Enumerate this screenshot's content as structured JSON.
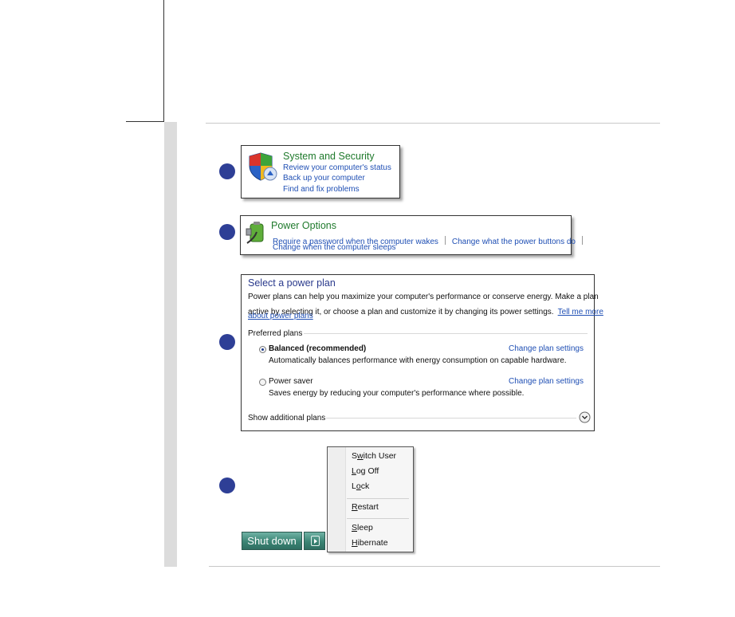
{
  "system_security": {
    "title": "System and Security",
    "links": [
      "Review your computer's status",
      "Back up your computer",
      "Find and fix problems"
    ]
  },
  "power_options": {
    "title": "Power Options",
    "link1": "Require a password when the computer wakes",
    "link2": "Change what the power buttons do",
    "link3": "Change when the computer sleeps"
  },
  "power_plan": {
    "title": "Select a power plan",
    "desc_line1": "Power plans can help you maximize your computer's performance or conserve energy. Make a plan",
    "desc_line2": "active by selecting it, or choose a plan and customize it by changing its power settings.",
    "tell_more_1": "Tell me more",
    "tell_more_2": "about power plans",
    "preferred_label": "Preferred plans",
    "plans": [
      {
        "name": "Balanced (recommended)",
        "desc": "Automatically balances performance with energy consumption on capable hardware.",
        "change": "Change plan settings",
        "selected": true
      },
      {
        "name": "Power saver",
        "desc": "Saves energy by reducing your computer's performance where possible.",
        "change": "Change plan settings",
        "selected": false
      }
    ],
    "show_more": "Show additional plans"
  },
  "shutdown_menu": {
    "button_label": "Shut down",
    "items": [
      "Switch User",
      "Log Off",
      "Lock",
      "Restart",
      "Sleep",
      "Hibernate"
    ],
    "mnemonics": [
      "w",
      "L",
      "o",
      "R",
      "S",
      "H"
    ]
  },
  "colors": {
    "step_badge": "#2e3f96",
    "heading_green": "#1f7a2c",
    "link_blue": "#1f4fb4",
    "plan_title": "#2a3a8c"
  }
}
